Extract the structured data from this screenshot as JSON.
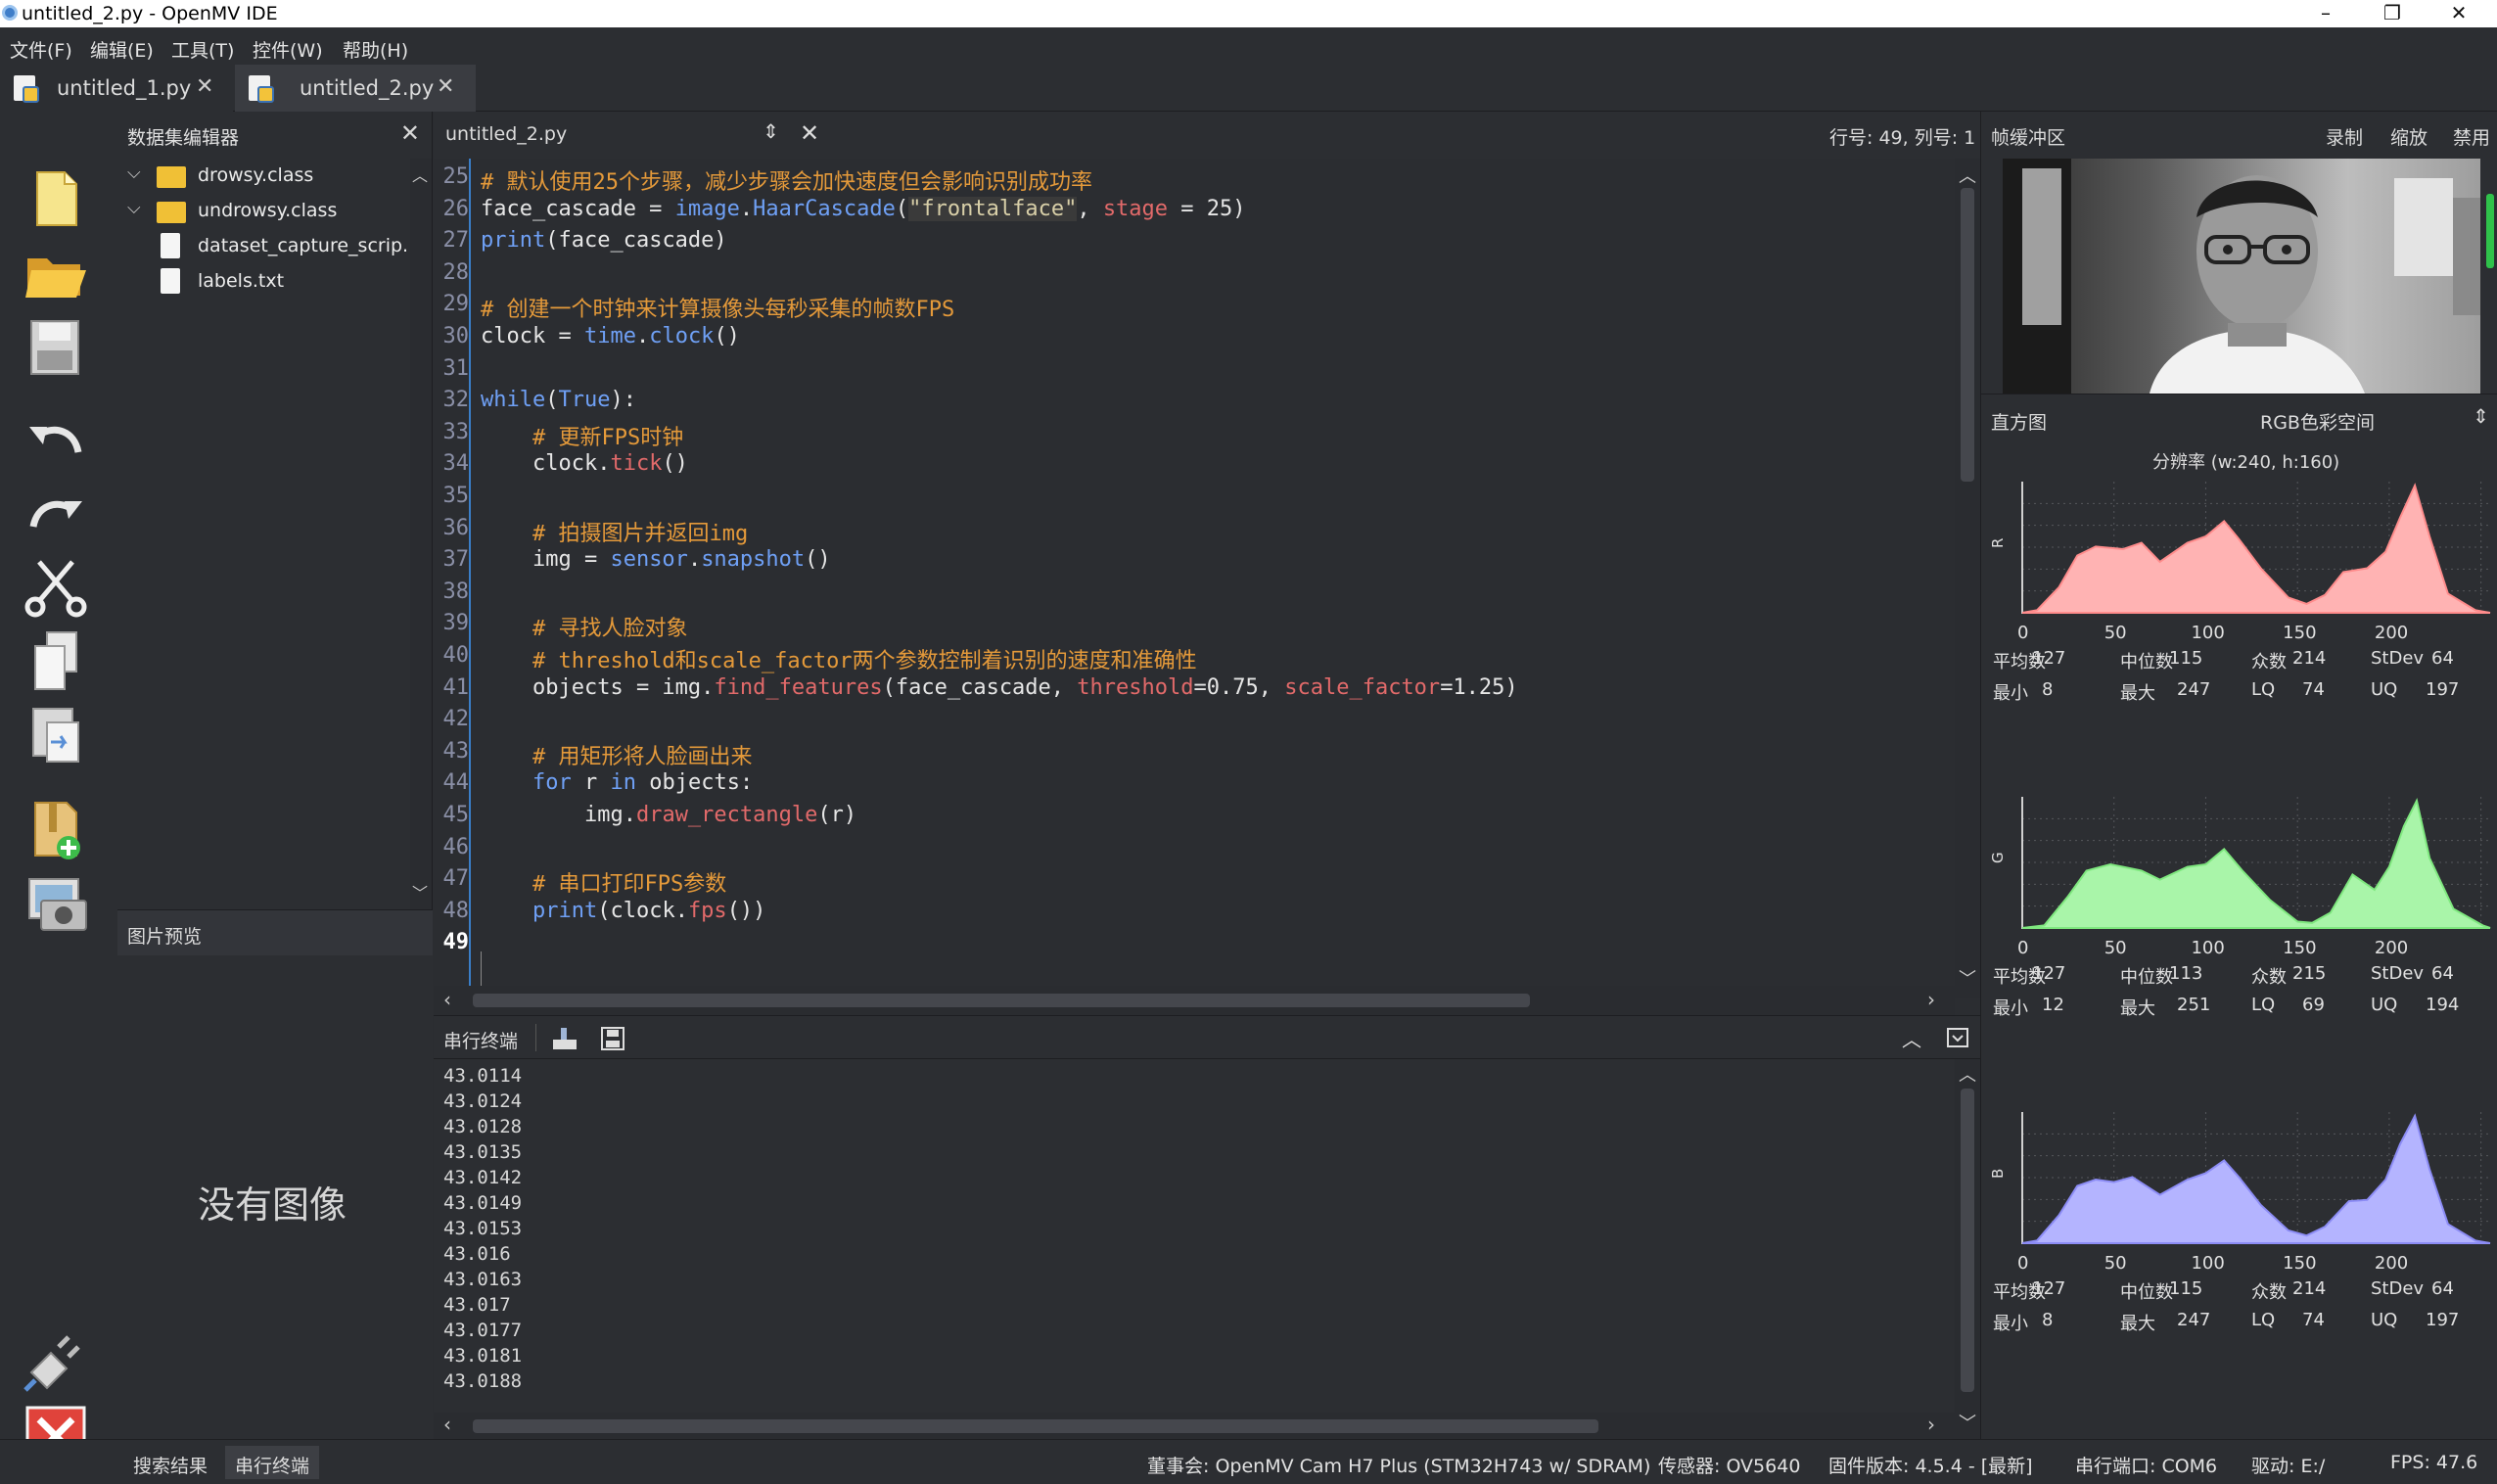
{
  "window": {
    "title": "untitled_2.py - OpenMV IDE",
    "min": "–",
    "max": "❐",
    "close": "✕"
  },
  "menu": [
    "文件(F)",
    "编辑(E)",
    "工具(T)",
    "控件(W)",
    "帮助(H)"
  ],
  "tabs": [
    {
      "label": "untitled_1.py",
      "active": false
    },
    {
      "label": "untitled_2.py",
      "active": true
    }
  ],
  "dataset_editor": {
    "title": "数据集编辑器",
    "items": [
      {
        "label": "drowsy.class",
        "type": "folder"
      },
      {
        "label": "undrowsy.class",
        "type": "folder"
      },
      {
        "label": "dataset_capture_scrip...",
        "type": "script"
      },
      {
        "label": "labels.txt",
        "type": "file"
      }
    ]
  },
  "image_preview": {
    "title": "图片预览",
    "empty_text": "没有图像"
  },
  "editor": {
    "filename": "untitled_2.py",
    "cursor_pos": "行号: 49, 列号: 1",
    "current_line": "49",
    "lines": [
      {
        "n": "25",
        "segs": [
          [
            "cmt",
            "# 默认使用25个步骤，减少步骤会加快速度但会影响识别成功率"
          ]
        ]
      },
      {
        "n": "26",
        "segs": [
          [
            "lgray",
            "face_cascade = "
          ],
          [
            "kw",
            "image"
          ],
          [
            "lgray",
            "."
          ],
          [
            "kw",
            "HaarCascade"
          ],
          [
            "lgray",
            "("
          ],
          [
            "str",
            "\"frontalface\""
          ],
          [
            "lgray",
            ", "
          ],
          [
            "fn",
            "stage"
          ],
          [
            "lgray",
            " = 25)"
          ]
        ]
      },
      {
        "n": "27",
        "segs": [
          [
            "kw",
            "print"
          ],
          [
            "lgray",
            "(face_cascade)"
          ]
        ]
      },
      {
        "n": "28",
        "segs": []
      },
      {
        "n": "29",
        "segs": [
          [
            "cmt",
            "# 创建一个时钟来计算摄像头每秒采集的帧数FPS"
          ]
        ]
      },
      {
        "n": "30",
        "segs": [
          [
            "lgray",
            "clock = "
          ],
          [
            "kw",
            "time"
          ],
          [
            "lgray",
            "."
          ],
          [
            "kw",
            "clock"
          ],
          [
            "lgray",
            "()"
          ]
        ]
      },
      {
        "n": "31",
        "segs": []
      },
      {
        "n": "32",
        "segs": [
          [
            "kw",
            "while"
          ],
          [
            "lgray",
            "("
          ],
          [
            "kw",
            "True"
          ],
          [
            "lgray",
            "):"
          ]
        ]
      },
      {
        "n": "33",
        "segs": [
          [
            "lgray",
            "    "
          ],
          [
            "cmt",
            "# 更新FPS时钟"
          ]
        ]
      },
      {
        "n": "34",
        "segs": [
          [
            "lgray",
            "    clock."
          ],
          [
            "fn",
            "tick"
          ],
          [
            "lgray",
            "()"
          ]
        ]
      },
      {
        "n": "35",
        "segs": []
      },
      {
        "n": "36",
        "segs": [
          [
            "lgray",
            "    "
          ],
          [
            "cmt",
            "# 拍摄图片并返回img"
          ]
        ]
      },
      {
        "n": "37",
        "segs": [
          [
            "lgray",
            "    img = "
          ],
          [
            "kw",
            "sensor"
          ],
          [
            "lgray",
            "."
          ],
          [
            "kw",
            "snapshot"
          ],
          [
            "lgray",
            "()"
          ]
        ]
      },
      {
        "n": "38",
        "segs": []
      },
      {
        "n": "39",
        "segs": [
          [
            "lgray",
            "    "
          ],
          [
            "cmt",
            "# 寻找人脸对象"
          ]
        ]
      },
      {
        "n": "40",
        "segs": [
          [
            "lgray",
            "    "
          ],
          [
            "cmt",
            "# threshold和scale_factor两个参数控制着识别的速度和准确性"
          ]
        ]
      },
      {
        "n": "41",
        "segs": [
          [
            "lgray",
            "    objects = img."
          ],
          [
            "fn",
            "find_features"
          ],
          [
            "lgray",
            "(face_cascade, "
          ],
          [
            "fn",
            "threshold"
          ],
          [
            "lgray",
            "=0.75, "
          ],
          [
            "fn",
            "scale_factor"
          ],
          [
            "lgray",
            "=1.25)"
          ]
        ]
      },
      {
        "n": "42",
        "segs": []
      },
      {
        "n": "43",
        "segs": [
          [
            "lgray",
            "    "
          ],
          [
            "cmt",
            "# 用矩形将人脸画出来"
          ]
        ]
      },
      {
        "n": "44",
        "segs": [
          [
            "lgray",
            "    "
          ],
          [
            "kw",
            "for"
          ],
          [
            "lgray",
            " r "
          ],
          [
            "kw",
            "in"
          ],
          [
            "lgray",
            " objects:"
          ]
        ]
      },
      {
        "n": "45",
        "segs": [
          [
            "lgray",
            "        img."
          ],
          [
            "fn",
            "draw_rectangle"
          ],
          [
            "lgray",
            "(r)"
          ]
        ]
      },
      {
        "n": "46",
        "segs": []
      },
      {
        "n": "47",
        "segs": [
          [
            "lgray",
            "    "
          ],
          [
            "cmt",
            "# 串口打印FPS参数"
          ]
        ]
      },
      {
        "n": "48",
        "segs": [
          [
            "lgray",
            "    "
          ],
          [
            "kw",
            "print"
          ],
          [
            "lgray",
            "(clock."
          ],
          [
            "fn",
            "fps"
          ],
          [
            "lgray",
            "())"
          ]
        ]
      },
      {
        "n": "49",
        "segs": []
      }
    ]
  },
  "terminal": {
    "title": "串行终端",
    "lines": [
      "43.0114",
      "43.0124",
      "43.0128",
      "43.0135",
      "43.0142",
      "43.0149",
      "43.0153",
      "43.016",
      "43.0163",
      "43.017",
      "43.0177",
      "43.0181",
      "43.0188"
    ]
  },
  "framebuffer": {
    "title": "帧缓冲区",
    "record": "录制",
    "zoom": "缩放",
    "disable": "禁用"
  },
  "histogram": {
    "title": "直方图",
    "colorspace": "RGB色彩空间",
    "resolution": "分辨率 (w:240, h:160)",
    "ticks": [
      "0",
      "50",
      "100",
      "150",
      "200"
    ],
    "channels": [
      {
        "name": "R",
        "color": "#ffb3b3",
        "stroke": "#ff8c8c",
        "stats": {
          "mean_label": "平均数",
          "mean": "127",
          "median_label": "中位数",
          "median": "115",
          "mode_label": "众数",
          "mode": "214",
          "stdev_label": "StDev",
          "stdev": "64",
          "min_label": "最小",
          "min": "8",
          "max_label": "最大",
          "max": "247",
          "lq_label": "LQ",
          "lq": "74",
          "uq_label": "UQ",
          "uq": "197"
        }
      },
      {
        "name": "G",
        "color": "#a9f5a9",
        "stroke": "#7fe87f",
        "stats": {
          "mean_label": "平均数",
          "mean": "127",
          "median_label": "中位数",
          "median": "113",
          "mode_label": "众数",
          "mode": "215",
          "stdev_label": "StDev",
          "stdev": "64",
          "min_label": "最小",
          "min": "12",
          "max_label": "最大",
          "max": "251",
          "lq_label": "LQ",
          "lq": "69",
          "uq_label": "UQ",
          "uq": "194"
        }
      },
      {
        "name": "B",
        "color": "#b4b4ff",
        "stroke": "#8c8cf5",
        "stats": {
          "mean_label": "平均数",
          "mean": "127",
          "median_label": "中位数",
          "median": "115",
          "mode_label": "众数",
          "mode": "214",
          "stdev_label": "StDev",
          "stdev": "64",
          "min_label": "最小",
          "min": "8",
          "max_label": "最大",
          "max": "247",
          "lq_label": "LQ",
          "lq": "74",
          "uq_label": "UQ",
          "uq": "197"
        }
      }
    ]
  },
  "statusbar": {
    "tab_search": "搜索结果",
    "tab_terminal": "串行终端",
    "board": "董事会: OpenMV Cam H7 Plus (STM32H743 w/ SDRAM)",
    "sensor": "传感器: OV5640",
    "firmware": "固件版本: 4.5.4 - [最新]",
    "port": "串行端口: COM6",
    "drive": "驱动: E:/",
    "fps": "FPS: 47.6"
  }
}
